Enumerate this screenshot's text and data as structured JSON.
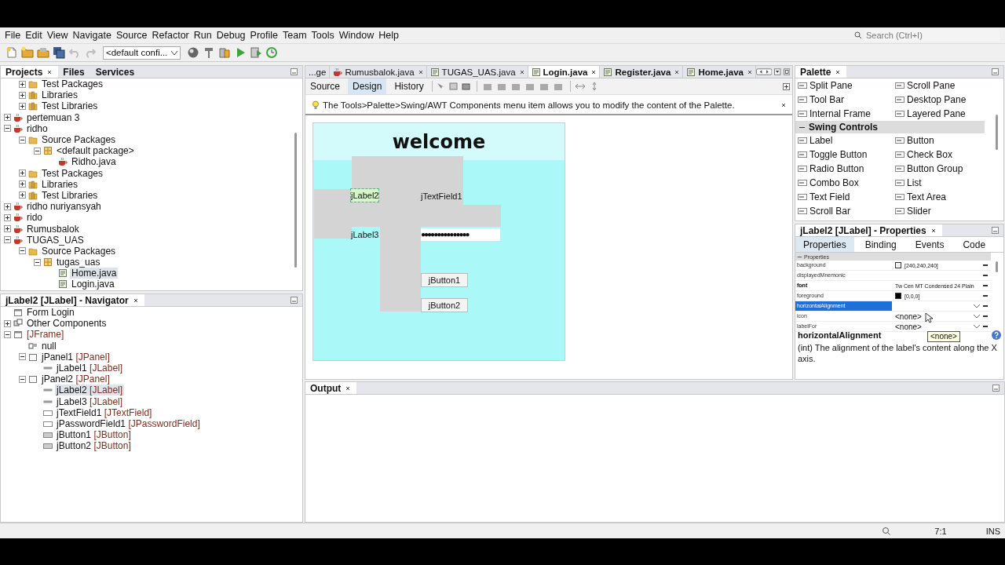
{
  "menu": [
    "File",
    "Edit",
    "View",
    "Navigate",
    "Source",
    "Refactor",
    "Run",
    "Debug",
    "Profile",
    "Team",
    "Tools",
    "Window",
    "Help"
  ],
  "search": {
    "placeholder": "Search (Ctrl+I)"
  },
  "toolbar": {
    "buttons": [
      {
        "disabled": false
      },
      {
        "disabled": false
      },
      {
        "disabled": false
      },
      {
        "disabled": false
      },
      {
        "disabled": true
      },
      {
        "disabled": true
      }
    ],
    "config": "<default confi...",
    "run_buttons": [
      {
        "disabled": false
      },
      {
        "disabled": false
      },
      {
        "disabled": false
      },
      {
        "disabled": false
      },
      {
        "disabled": false
      },
      {
        "disabled": false
      }
    ]
  },
  "projects": {
    "tabs": [
      {
        "label": "Projects",
        "selected": true,
        "closable": true
      },
      {
        "label": "Files",
        "selected": false,
        "closable": false
      },
      {
        "label": "Services",
        "selected": false,
        "closable": false
      }
    ],
    "partial_items": [
      {
        "label": "Test Packages",
        "kind": "folder",
        "expanded": false,
        "selected": false
      },
      {
        "label": "Libraries",
        "kind": "library",
        "expanded": false,
        "selected": false
      },
      {
        "label": "Test Libraries",
        "kind": "library",
        "expanded": false,
        "selected": false
      }
    ],
    "tree": [
      {
        "label": "pertemuan 3",
        "kind": "project",
        "expanded": false,
        "selected": false
      },
      {
        "label": "ridho",
        "kind": "project",
        "expanded": true,
        "selected": false,
        "children": [
          {
            "label": "Source Packages",
            "kind": "folder",
            "expanded": true,
            "selected": false,
            "children": [
              {
                "label": "<default package>",
                "kind": "package",
                "expanded": true,
                "selected": false,
                "children": [
                  {
                    "label": "Ridho.java",
                    "kind": "java_class",
                    "selected": false
                  }
                ]
              }
            ]
          },
          {
            "label": "Test Packages",
            "kind": "folder",
            "expanded": false,
            "selected": false
          },
          {
            "label": "Libraries",
            "kind": "library",
            "expanded": false,
            "selected": false
          },
          {
            "label": "Test Libraries",
            "kind": "library",
            "expanded": false,
            "selected": false
          }
        ]
      },
      {
        "label": "ridho nuriyansyah",
        "kind": "project",
        "expanded": false,
        "selected": false
      },
      {
        "label": "rido",
        "kind": "project",
        "expanded": false,
        "selected": false
      },
      {
        "label": "Rumusbalok",
        "kind": "project",
        "expanded": false,
        "selected": false
      },
      {
        "label": "TUGAS_UAS",
        "kind": "project",
        "expanded": true,
        "selected": false,
        "children": [
          {
            "label": "Source Packages",
            "kind": "folder",
            "expanded": true,
            "selected": false,
            "children": [
              {
                "label": "tugas_uas",
                "kind": "package",
                "expanded": true,
                "selected": false,
                "children": [
                  {
                    "label": "Home.java",
                    "kind": "java_form",
                    "selected": true
                  },
                  {
                    "label": "Login.java",
                    "kind": "java_form",
                    "selected": false
                  }
                ]
              }
            ]
          }
        ]
      }
    ]
  },
  "navigator": {
    "title": "jLabel2 [JLabel] - Navigator",
    "tree": [
      {
        "name": "Form Login",
        "kind": "form",
        "selected": false
      },
      {
        "name": "Other Components",
        "kind": "components",
        "expanded": false,
        "selected": false
      },
      {
        "type": "[JFrame]",
        "kind": "frame",
        "expanded": true,
        "selected": false,
        "children": [
          {
            "name": "null",
            "kind": "layout",
            "selected": false
          },
          {
            "name": "jPanel1",
            "type": "[JPanel]",
            "kind": "panel",
            "expanded": true,
            "selected": false,
            "children": [
              {
                "name": "jLabel1",
                "type": "[JLabel]",
                "kind": "label",
                "selected": false
              }
            ]
          },
          {
            "name": "jPanel2",
            "type": "[JPanel]",
            "kind": "panel",
            "expanded": true,
            "selected": false,
            "children": [
              {
                "name": "jLabel2",
                "type": "[JLabel]",
                "kind": "label",
                "selected": true
              },
              {
                "name": "jLabel3",
                "type": "[JLabel]",
                "kind": "label",
                "selected": false
              },
              {
                "name": "jTextField1",
                "type": "[JTextField]",
                "kind": "textfield",
                "selected": false
              },
              {
                "name": "jPasswordField1",
                "type": "[JPasswordField]",
                "kind": "passwordfield",
                "selected": false
              },
              {
                "name": "jButton1",
                "type": "[JButton]",
                "kind": "button",
                "selected": false
              },
              {
                "name": "jButton2",
                "type": "[JButton]",
                "kind": "button",
                "selected": false
              }
            ]
          }
        ]
      }
    ]
  },
  "editor": {
    "tabs": [
      {
        "label": "...ge",
        "kind": "partial",
        "selected": false,
        "modified": false
      },
      {
        "label": "Rumusbalok.java",
        "kind": "class",
        "selected": false,
        "modified": false
      },
      {
        "label": "TUGAS_UAS.java",
        "kind": "form",
        "selected": false,
        "modified": false
      },
      {
        "label": "Login.java",
        "kind": "form",
        "selected": true,
        "modified": true
      },
      {
        "label": "Register.java",
        "kind": "form",
        "selected": false,
        "modified": true
      },
      {
        "label": "Home.java",
        "kind": "form",
        "selected": false,
        "modified": true
      }
    ],
    "views": [
      {
        "label": "Source",
        "selected": false
      },
      {
        "label": "Design",
        "selected": true
      },
      {
        "label": "History",
        "selected": false
      }
    ],
    "hint": "The Tools>Palette>Swing/AWT Components menu item allows you to modify the content of the Palette.",
    "form": [
      {
        "kind": "heading",
        "text": "welcome",
        "selected": false
      },
      {
        "kind": "label",
        "text": "jLabel2",
        "selected": true
      },
      {
        "kind": "textfield",
        "text": "jTextField1",
        "selected": false
      },
      {
        "kind": "label",
        "text": "jLabel3",
        "selected": false
      },
      {
        "kind": "password",
        "text": "●●●●●●●●●●●●●●●",
        "selected": false
      },
      {
        "kind": "button",
        "text": "jButton1",
        "selected": false
      },
      {
        "kind": "button",
        "text": "jButton2",
        "selected": false
      }
    ]
  },
  "palette": {
    "title": "Palette",
    "sections": [
      {
        "kind": "partial",
        "items": [
          "Split Pane",
          "Scroll Pane",
          "Tool Bar",
          "Desktop Pane",
          "Internal Frame",
          "Layered Pane"
        ]
      },
      {
        "kind": "group",
        "label": "Swing Controls",
        "expanded": true,
        "items": [
          "Label",
          "Button",
          "Toggle Button",
          "Check Box",
          "Radio Button",
          "Button Group",
          "Combo Box",
          "List",
          "Text Field",
          "Text Area",
          "Scroll Bar",
          "Slider"
        ]
      }
    ]
  },
  "properties": {
    "title": "jLabel2 [JLabel] - Properties",
    "tabs": [
      {
        "label": "Properties",
        "selected": true
      },
      {
        "label": "Binding",
        "selected": false
      },
      {
        "label": "Events",
        "selected": false
      },
      {
        "label": "Code",
        "selected": false
      }
    ],
    "section": "Properties",
    "rows": [
      {
        "name": "background",
        "kind": "color",
        "color": "#f0f0f0",
        "value": "[240,240,240]",
        "modified": false,
        "selected": false
      },
      {
        "name": "displayedMnemonic",
        "kind": "text",
        "modified": false,
        "selected": false
      },
      {
        "name": "font",
        "kind": "text",
        "value": "Tw Cen MT Condensed 24 Plain",
        "modified": true,
        "selected": false
      },
      {
        "name": "foreground",
        "kind": "color",
        "color": "#000000",
        "value": "[0,0,0]",
        "modified": false,
        "selected": false
      },
      {
        "name": "horizontalAlignment",
        "kind": "combo",
        "modified": false,
        "selected": true
      },
      {
        "name": "icon",
        "kind": "combo",
        "value": "<none>",
        "modified": false,
        "selected": false
      },
      {
        "name": "labelFor",
        "kind": "combo",
        "value": "<none>",
        "modified": false,
        "selected": false
      }
    ],
    "tooltip": "<none>",
    "description_title": "horizontalAlignment",
    "description": "(int) The alignment of the label's content along the X axis."
  },
  "output": {
    "title": "Output"
  },
  "status": {
    "position": "7:1",
    "mode": "INS"
  }
}
